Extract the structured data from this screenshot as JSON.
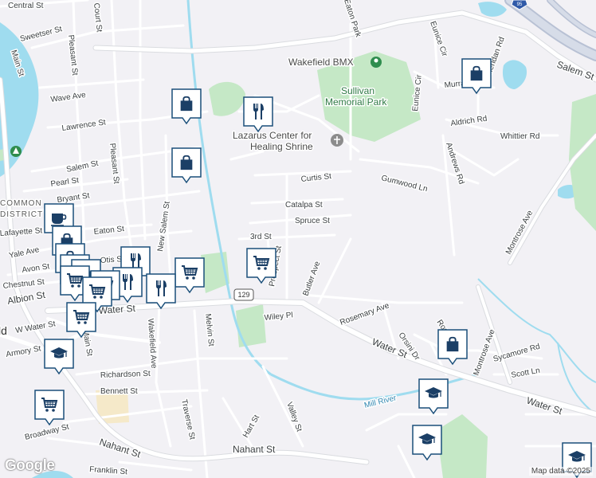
{
  "map": {
    "streets": [
      {
        "id": "central",
        "text": "Central St"
      },
      {
        "id": "court",
        "text": "Court St"
      },
      {
        "id": "sweetser",
        "text": "Sweetser St"
      },
      {
        "id": "main",
        "text": "Main St"
      },
      {
        "id": "pleasant1",
        "text": "Pleasant St"
      },
      {
        "id": "wave",
        "text": "Wave Ave"
      },
      {
        "id": "lawrence",
        "text": "Lawrence St"
      },
      {
        "id": "salem1",
        "text": "Salem St"
      },
      {
        "id": "pearl",
        "text": "Pearl St"
      },
      {
        "id": "bryant",
        "text": "Bryant St"
      },
      {
        "id": "pleasant2",
        "text": "Pleasant St"
      },
      {
        "id": "newsalem",
        "text": "New Salem St"
      },
      {
        "id": "lafayette",
        "text": "Lafayette St"
      },
      {
        "id": "eaton",
        "text": "Eaton St"
      },
      {
        "id": "yale",
        "text": "Yale Ave"
      },
      {
        "id": "otis",
        "text": "Otis St"
      },
      {
        "id": "avon",
        "text": "Avon St"
      },
      {
        "id": "chestnut",
        "text": "Chestnut St"
      },
      {
        "id": "albion",
        "text": "Albion St"
      },
      {
        "id": "water1",
        "text": "Water St"
      },
      {
        "id": "wwater",
        "text": "W Water St"
      },
      {
        "id": "armory",
        "text": "Armory St"
      },
      {
        "id": "main2",
        "text": "Main St"
      },
      {
        "id": "wakefieldave",
        "text": "Wakefield Ave"
      },
      {
        "id": "melvin",
        "text": "Melvin St"
      },
      {
        "id": "richardson",
        "text": "Richardson St"
      },
      {
        "id": "bennett",
        "text": "Bennett St"
      },
      {
        "id": "traverse",
        "text": "Traverse St"
      },
      {
        "id": "broadway",
        "text": "Broadway St"
      },
      {
        "id": "nahant1",
        "text": "Nahant St"
      },
      {
        "id": "nahant2",
        "text": "Nahant St"
      },
      {
        "id": "franklin",
        "text": "Franklin St"
      },
      {
        "id": "hart",
        "text": "Hart St"
      },
      {
        "id": "valley",
        "text": "Valley St"
      },
      {
        "id": "wiley",
        "text": "Wiley Pl"
      },
      {
        "id": "thirdst",
        "text": "3rd St"
      },
      {
        "id": "prospect",
        "text": "Prospect St"
      },
      {
        "id": "butler",
        "text": "Butler Ave"
      },
      {
        "id": "spruce",
        "text": "Spruce St"
      },
      {
        "id": "catalpa",
        "text": "Catalpa St"
      },
      {
        "id": "curtis",
        "text": "Curtis St"
      },
      {
        "id": "gumwood",
        "text": "Gumwood Ln"
      },
      {
        "id": "eaton2",
        "text": "Eaton Park"
      },
      {
        "id": "eunice",
        "text": "Eunice Cir"
      },
      {
        "id": "eunice2",
        "text": "Eunice Cir"
      },
      {
        "id": "murray",
        "text": "Murray Ave"
      },
      {
        "id": "sheridan",
        "text": "Sheridan Rd"
      },
      {
        "id": "aldrich",
        "text": "Aldrich Rd"
      },
      {
        "id": "whittier",
        "text": "Whittier Rd"
      },
      {
        "id": "andrews",
        "text": "Andrews Rd"
      },
      {
        "id": "salem2",
        "text": "Salem St"
      },
      {
        "id": "montrose1",
        "text": "Montrose Ave"
      },
      {
        "id": "montrose2",
        "text": "Montrose Ave"
      },
      {
        "id": "rosemary",
        "text": "Rosemary Ave"
      },
      {
        "id": "orsini",
        "text": "Orsini Dr"
      },
      {
        "id": "roseland",
        "text": "Roseland"
      },
      {
        "id": "sycamore",
        "text": "Sycamore Rd"
      },
      {
        "id": "scott",
        "text": "Scott Ln"
      },
      {
        "id": "water2",
        "text": "Water St"
      },
      {
        "id": "water3",
        "text": "Water St"
      },
      {
        "id": "millriver",
        "text": "Mill River"
      }
    ],
    "places": [
      {
        "id": "bmx",
        "text": "Wakefield BMX"
      },
      {
        "id": "sullivan1",
        "text": "Sullivan"
      },
      {
        "id": "sullivan2",
        "text": "Memorial Park"
      },
      {
        "id": "lazarus1",
        "text": "Lazarus Center for"
      },
      {
        "id": "lazarus2",
        "text": "Healing Shrine"
      },
      {
        "id": "common1",
        "text": "COMMON"
      },
      {
        "id": "common2",
        "text": "DISTRICT"
      },
      {
        "id": "wakefield",
        "text": "Wakefield"
      }
    ],
    "route_shield": "129",
    "highway_shield": "95",
    "attribution": "Map data ©2025",
    "logo": "Google",
    "colors": {
      "land": "#f2f1f5",
      "water": "#9fdcef",
      "park": "#c5e8c6",
      "road": "#ffffff",
      "marker_fill": "#ffffff",
      "marker_border": "#1a4f7a",
      "icon": "#1b3f66"
    }
  }
}
